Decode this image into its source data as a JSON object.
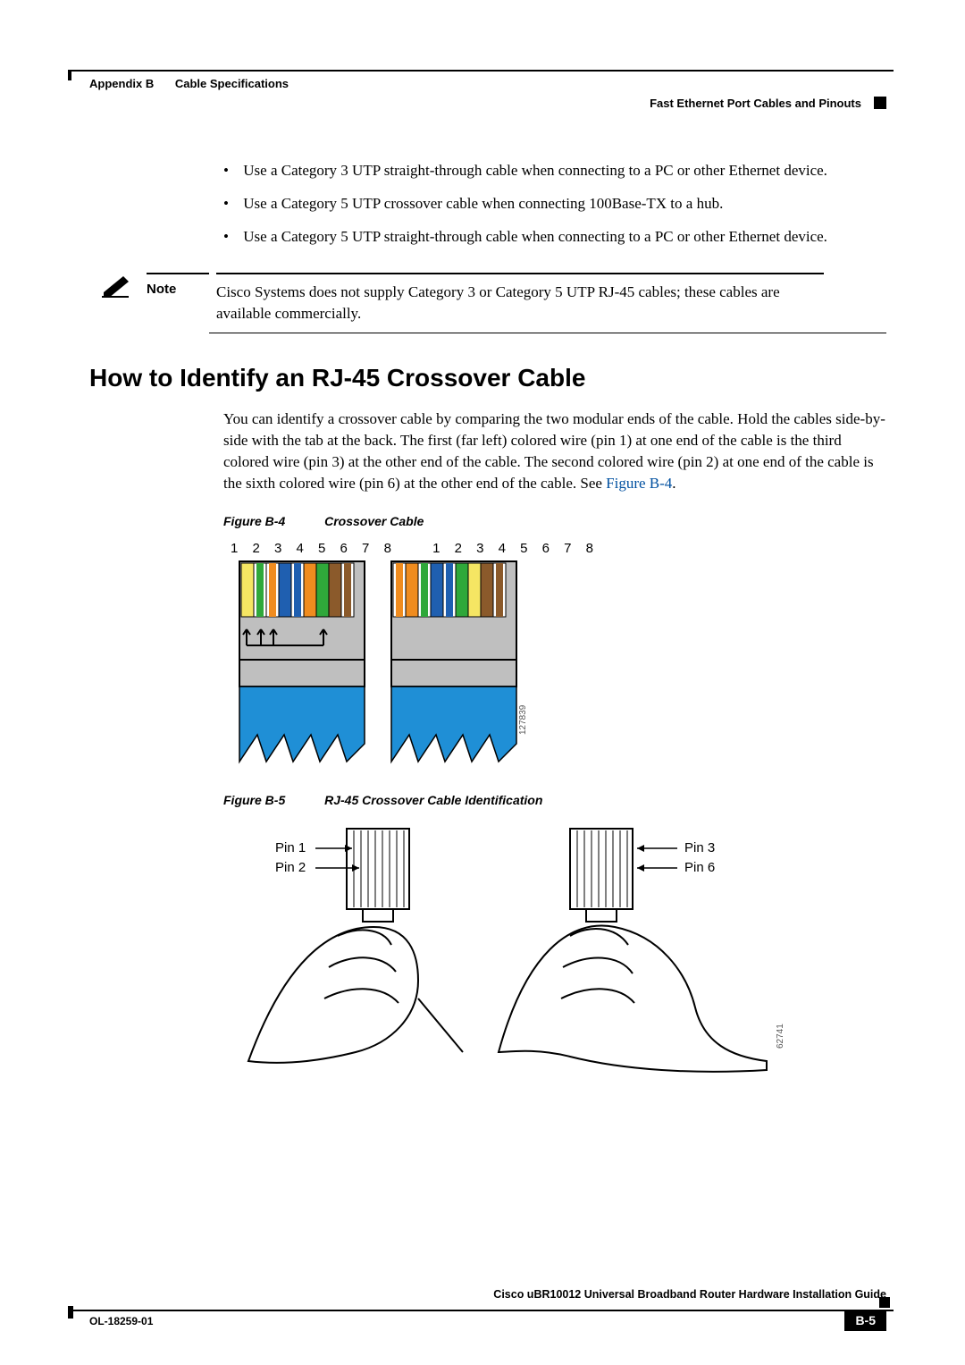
{
  "header": {
    "appendix": "Appendix B",
    "chapter": "Cable Specifications",
    "section": "Fast Ethernet Port Cables and Pinouts"
  },
  "bullets": [
    "Use a Category 3 UTP straight-through cable when connecting to a PC or other Ethernet device.",
    "Use a Category 5 UTP crossover cable when connecting 100Base-TX to a hub.",
    "Use a Category 5 UTP straight-through cable when connecting to a PC or other Ethernet device."
  ],
  "note": {
    "label": "Note",
    "text": "Cisco Systems does not supply Category 3 or Category 5 UTP RJ-45 cables; these cables are available commercially."
  },
  "heading": "How to Identify an RJ-45 Crossover Cable",
  "paragraph_pre": "You can identify a crossover cable by comparing the two modular ends of the cable. Hold the cables side-by-side with the tab at the back. The first (far left) colored wire (pin 1) at one end of the cable is the third colored wire (pin 3) at the other end of the cable. The second colored wire (pin 2) at one end of the cable is the sixth colored wire (pin 6) at the other end of the cable. See ",
  "paragraph_link": "Figure B-4",
  "paragraph_post": ".",
  "figureB4": {
    "label": "Figure B-4",
    "title": "Crossover Cable",
    "pins": "1 2 3 4 5 6 7 8",
    "id": "127839"
  },
  "figureB5": {
    "label": "Figure B-5",
    "title": "RJ-45 Crossover Cable Identification",
    "pin1": "Pin 1",
    "pin2": "Pin 2",
    "pin3": "Pin 3",
    "pin6": "Pin 6",
    "id": "62741"
  },
  "footer": {
    "title": "Cisco uBR10012 Universal Broadband Router Hardware Installation Guide",
    "docnum": "OL-18259-01",
    "page": "B-5"
  }
}
